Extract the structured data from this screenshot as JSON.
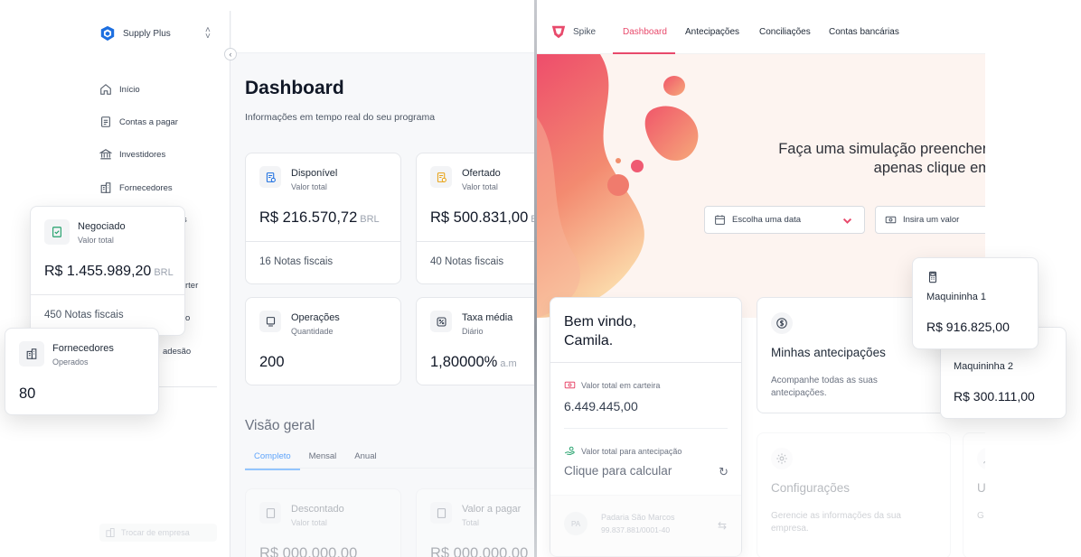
{
  "left_app": {
    "brand": {
      "name": "Supply Plus"
    },
    "sidebar": {
      "items": [
        {
          "label": "Início",
          "icon": "home-icon"
        },
        {
          "label": "Contas a pagar",
          "icon": "document-icon"
        },
        {
          "label": "Investidores",
          "icon": "bank-icon"
        },
        {
          "label": "Fornecedores",
          "icon": "building-icon"
        }
      ],
      "partial_labels": [
        "s",
        "rter",
        "o",
        "adesão"
      ],
      "switch_company": "Trocar de empresa"
    },
    "page": {
      "title": "Dashboard",
      "subtitle": "Informações em tempo real do seu programa"
    },
    "kpis": [
      {
        "title": "Disponível",
        "sub": "Valor total",
        "value": "R$ 216.570,72",
        "unit": "BRL",
        "foot": "16 Notas fiscais"
      },
      {
        "title": "Ofertado",
        "sub": "Valor total",
        "value": "R$ 500.831,00",
        "unit": "B",
        "foot": "40 Notas fiscais"
      },
      {
        "title": "Operações",
        "sub": "Quantidade",
        "value": "200"
      },
      {
        "title": "Taxa média",
        "sub": "Diário",
        "value": "1,80000%",
        "unit": "a.m"
      }
    ],
    "overview": {
      "title": "Visão geral",
      "tabs": [
        "Completo",
        "Mensal",
        "Anual"
      ],
      "active_tab": "Completo",
      "cards": [
        {
          "title": "Descontado",
          "sub": "Valor total",
          "value": "R$ 000.000,00"
        },
        {
          "title": "Valor a pagar",
          "sub": "Total",
          "value": "R$ 000.000,00"
        }
      ]
    }
  },
  "right_app": {
    "brand": {
      "name": "Spike"
    },
    "nav": [
      "Dashboard",
      "Antecipações",
      "Conciliações",
      "Contas bancárias"
    ],
    "active_nav": "Dashboard",
    "hero": {
      "line1": "Faça uma simulação preenchen",
      "line2": "apenas clique em",
      "date_placeholder": "Escolha uma data",
      "value_placeholder": "Insira um valor"
    },
    "welcome": {
      "greeting_line1": "Bem vindo,",
      "greeting_line2": "Camila.",
      "wallet_label": "Valor total em carteira",
      "wallet_value": "6.449.445,00",
      "advance_label": "Valor total para antecipação",
      "advance_cta": "Clique para calcular",
      "row_avatar": "PA",
      "row_name": "Padaria São Marcos",
      "row_doc": "99.837.881/0001-40"
    },
    "cards": [
      {
        "title": "Minhas antecipações",
        "desc": "Acompanhe todas as suas antecipações."
      },
      {
        "title": "Configurações",
        "desc": "Gerencie as informações da sua empresa."
      },
      {
        "title": "U",
        "desc": "G"
      }
    ]
  },
  "floating": {
    "negociado": {
      "title": "Negociado",
      "sub": "Valor total",
      "value": "R$ 1.455.989,20",
      "unit": "BRL",
      "foot": "450 Notas fiscais"
    },
    "fornecedores": {
      "title": "Fornecedores",
      "sub": "Operados",
      "value": "80"
    },
    "maquininha1": {
      "title": "Maquininha 1",
      "value": "R$ 916.825,00"
    },
    "maquininha2": {
      "title": "Maquininha 2",
      "value": "R$ 300.111,00"
    }
  },
  "colors": {
    "accent_blue": "#1d6fe0",
    "accent_pink": "#e8496b",
    "accent_green": "#22a06b",
    "accent_amber": "#e8a317"
  }
}
